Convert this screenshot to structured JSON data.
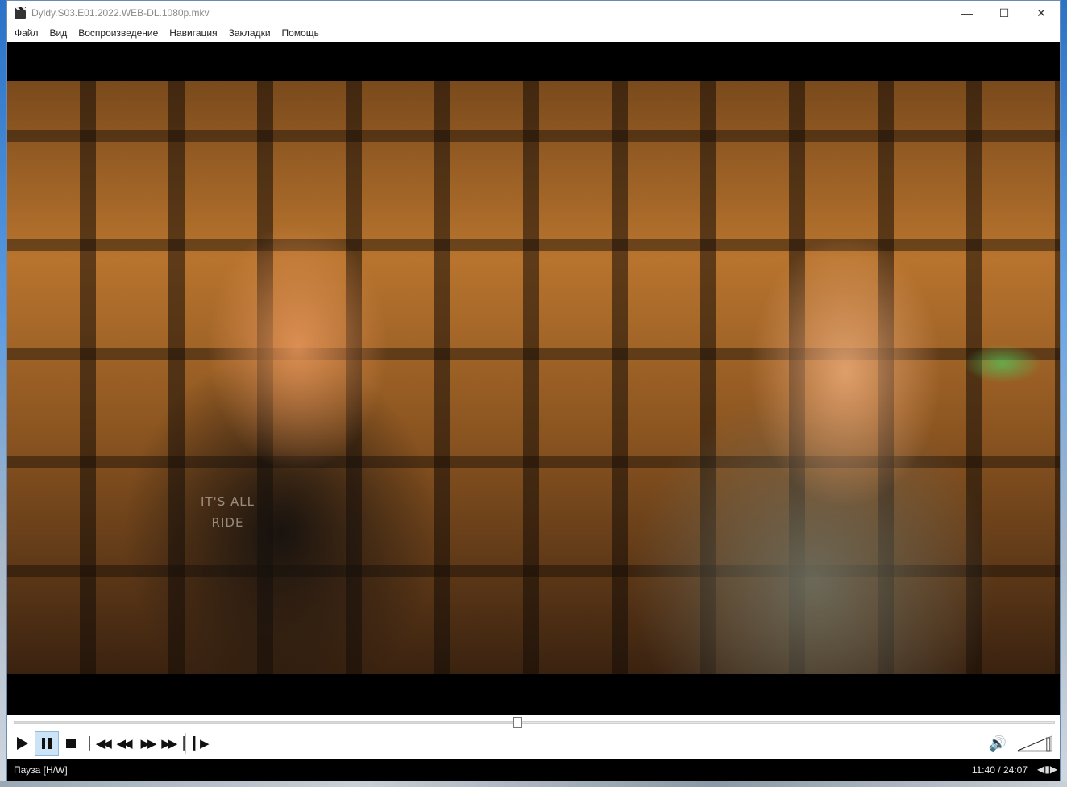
{
  "window": {
    "title": "Dyldy.S03.E01.2022.WEB-DL.1080p.mkv",
    "controls": {
      "minimize": "—",
      "maximize": "☐",
      "close": "✕"
    }
  },
  "menu": {
    "items": [
      {
        "label": "Файл"
      },
      {
        "label": "Вид"
      },
      {
        "label": "Воспроизведение"
      },
      {
        "label": "Навигация"
      },
      {
        "label": "Закладки"
      },
      {
        "label": "Помощь"
      }
    ]
  },
  "video": {
    "shirt_text": "IT'S ALL\nRIDE"
  },
  "playback": {
    "position_fraction": 0.484,
    "volume_fraction": 0.9,
    "buttons": {
      "play": "play-icon",
      "pause": "pause-icon",
      "stop": "stop-icon",
      "previous": "skip-previous-icon",
      "rewind": "rewind-icon",
      "forward": "fast-forward-icon",
      "next": "skip-next-icon",
      "frame_step": "frame-step-icon"
    }
  },
  "status": {
    "state": "Пауза [H/W]",
    "time": "11:40 / 24:07"
  },
  "colors": {
    "active_button_bg": "#cde4f7",
    "statusbar_bg": "#000000",
    "letterbox": "#000000"
  }
}
